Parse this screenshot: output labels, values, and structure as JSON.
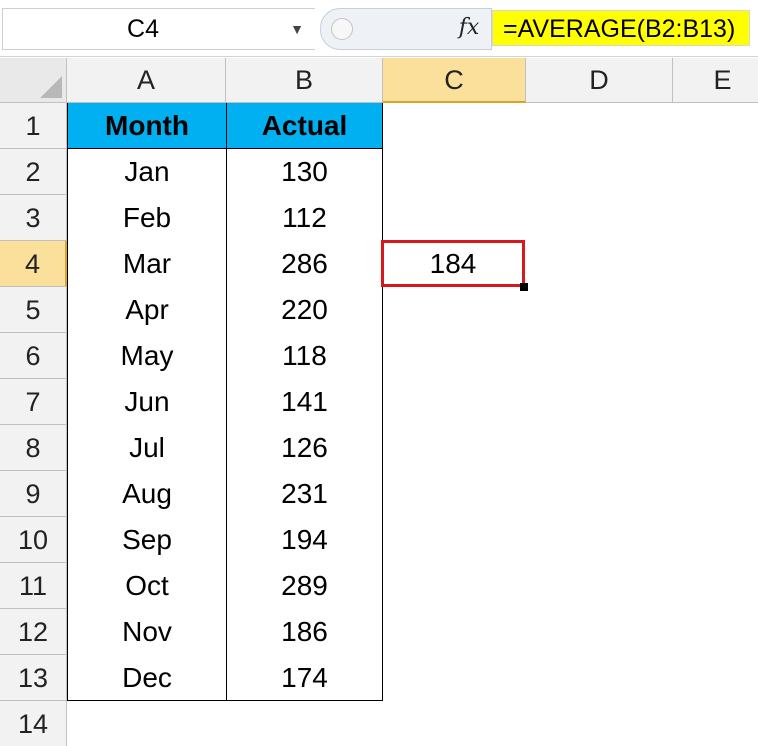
{
  "name_box": {
    "value": "C4",
    "dropdown_icon": "chevron-down-icon"
  },
  "formula_bar": {
    "fx_label": "fx",
    "formula": "=AVERAGE(B2:B13)",
    "highlight_color": "#ffff00"
  },
  "columns": [
    "A",
    "B",
    "C",
    "D",
    "E"
  ],
  "rows": [
    "1",
    "2",
    "3",
    "4",
    "5",
    "6",
    "7",
    "8",
    "9",
    "10",
    "11",
    "12",
    "13",
    "14"
  ],
  "selected": {
    "cell": "C4",
    "column": "C",
    "row": "4",
    "value": "184",
    "border_color": "#d9181e"
  },
  "table": {
    "header_color": "#00b0f0",
    "headers": [
      "Month",
      "Actual"
    ],
    "rows": [
      {
        "month": "Jan",
        "actual": "130"
      },
      {
        "month": "Feb",
        "actual": "112"
      },
      {
        "month": "Mar",
        "actual": "286"
      },
      {
        "month": "Apr",
        "actual": "220"
      },
      {
        "month": "May",
        "actual": "118"
      },
      {
        "month": "Jun",
        "actual": "141"
      },
      {
        "month": "Jul",
        "actual": "126"
      },
      {
        "month": "Aug",
        "actual": "231"
      },
      {
        "month": "Sep",
        "actual": "194"
      },
      {
        "month": "Oct",
        "actual": "289"
      },
      {
        "month": "Nov",
        "actual": "186"
      },
      {
        "month": "Dec",
        "actual": "174"
      }
    ]
  }
}
